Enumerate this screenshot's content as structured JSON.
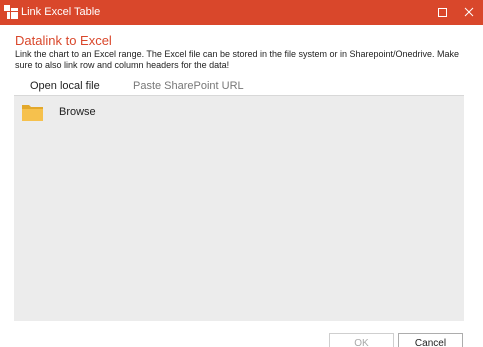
{
  "window": {
    "title": "Link Excel Table",
    "app_icon": "app-logo-icon",
    "controls": [
      "maximize-icon",
      "close-icon"
    ],
    "accent_color": "#d9472b"
  },
  "dialog": {
    "heading": "Datalink to Excel",
    "description": "Link the chart to an Excel range. The Excel file can be stored in the file system or in Sharepoint/Onedrive. Make sure to also link row and column headers for the data!"
  },
  "tabs": [
    {
      "label": "Open local file",
      "active": true
    },
    {
      "label": "Paste SharePoint URL",
      "active": false
    }
  ],
  "browse": {
    "label": "Browse",
    "icon": "folder-icon"
  },
  "buttons": {
    "ok": "OK",
    "cancel": "Cancel",
    "ok_enabled": false
  }
}
